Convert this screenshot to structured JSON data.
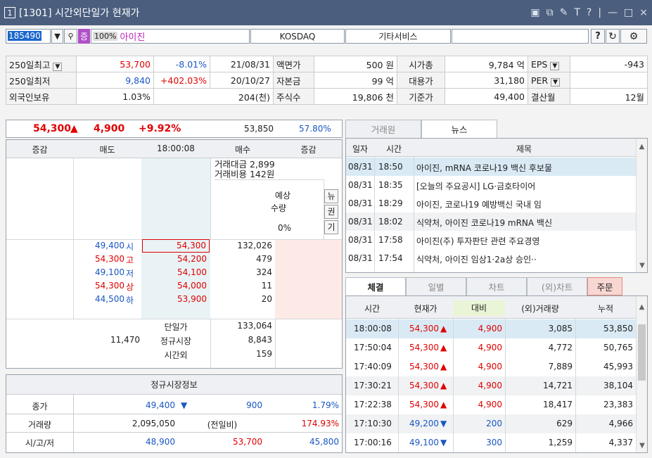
{
  "window": {
    "num": "1",
    "title": "[1301] 시간외단일가 현재가",
    "controls": [
      "▣",
      "⧉",
      "✎",
      "T",
      "?",
      "|",
      "—",
      "□",
      "×"
    ]
  },
  "toolbar": {
    "code": "185490",
    "badge": "증",
    "margin": "100%",
    "name": "아이진",
    "market": "KOSDAQ",
    "sector": "기타서비스",
    "help": "?",
    "refresh": "↻",
    "settings": "⚙"
  },
  "info": {
    "rows": [
      {
        "label": "250일최고",
        "value": "53,700",
        "change": "-8.01%",
        "date": "21/08/31",
        "k1": "액면가",
        "v1": "500 원",
        "k2": "시가총",
        "v2": "9,784 억",
        "k3": "EPS",
        "v3": "-943"
      },
      {
        "label": "250일최저",
        "value": "9,840",
        "change": "+402.03%",
        "date": "20/10/27",
        "k1": "자본금",
        "v1": "99 억",
        "k2": "대용가",
        "v2": "31,180",
        "k3": "PER",
        "v3": ""
      },
      {
        "label": "외국인보유",
        "value": "1.03%",
        "change": "",
        "date": "204(천)",
        "k1": "주식수",
        "v1": "19,806 천",
        "k2": "기준가",
        "v2": "49,400",
        "k3": "결산월",
        "v3": "12월"
      }
    ]
  },
  "quote": {
    "price": "54,300",
    "diff": "4,900",
    "rate": "+9.92%",
    "volume": "53,850",
    "ratio": "57.80%"
  },
  "orderbook": {
    "headers": [
      "증감",
      "매도",
      "18:00:08",
      "매수",
      "증감"
    ],
    "amount": "거래대금 2,899",
    "cost": "거래비용 142원",
    "expect_label1": "예상",
    "expect_label2": "수량",
    "expect_value": "0%",
    "side_btns": [
      "뉴",
      "권",
      "기"
    ],
    "rows": [
      {
        "ref": "49,400",
        "tag": "시",
        "price": "54,300",
        "buy": "132,026",
        "color": "blue"
      },
      {
        "ref": "54,300",
        "tag": "고",
        "price": "54,200",
        "buy": "479",
        "color": "red"
      },
      {
        "ref": "49,100",
        "tag": "저",
        "price": "54,100",
        "buy": "324",
        "color": "blue"
      },
      {
        "ref": "54,300",
        "tag": "상",
        "price": "54,000",
        "buy": "11",
        "color": "red"
      },
      {
        "ref": "44,500",
        "tag": "하",
        "price": "53,900",
        "buy": "20",
        "color": "blue"
      }
    ],
    "sum_left": "11,470",
    "sum_labels": [
      "단일가",
      "정규시장",
      "시간외"
    ],
    "sum_values": [
      "133,064",
      "8,843",
      "159"
    ]
  },
  "regular": {
    "title": "정규시장정보",
    "rows": [
      {
        "k": "종가",
        "a": "49,400",
        "mark": "▼",
        "b": "900",
        "c": "1.79%"
      },
      {
        "k": "거래량",
        "a": "2,095,050",
        "mark": "",
        "b": "(전일비)",
        "c": "174.93%"
      },
      {
        "k": "시/고/저",
        "a": "48,900",
        "mark": "",
        "b": "53,700",
        "c": "45,800"
      }
    ]
  },
  "news": {
    "tabs": [
      "거래원",
      "뉴스"
    ],
    "headers": [
      "일자",
      "시간",
      "제목"
    ],
    "rows": [
      {
        "d": "08/31",
        "t": "18:50",
        "s": "아이진, mRNA 코로나19 백신 후보물"
      },
      {
        "d": "08/31",
        "t": "18:35",
        "s": "[오늘의 주요공시] LG·금호타이어"
      },
      {
        "d": "08/31",
        "t": "18:29",
        "s": "아이진, 코로나19 예방백신 국내 임"
      },
      {
        "d": "08/31",
        "t": "18:02",
        "s": "식약처, 아이진 코로나19 mRNA 백신"
      },
      {
        "d": "08/31",
        "t": "17:58",
        "s": "아이진(주) 투자판단 관련 주요경영"
      },
      {
        "d": "08/31",
        "t": "17:54",
        "s": "식약처, 아이진 임상1·2a상 승인··"
      }
    ]
  },
  "trades": {
    "tabs": [
      "체결",
      "일별",
      "차트",
      "(외)차트",
      "주문"
    ],
    "headers": [
      "시간",
      "현재가",
      "대비",
      "(외)거래량",
      "누적"
    ],
    "rows": [
      {
        "t": "18:00:08",
        "p": "54,300",
        "up": true,
        "d": "4,900",
        "v": "3,085",
        "a": "53,850"
      },
      {
        "t": "17:50:04",
        "p": "54,300",
        "up": true,
        "d": "4,900",
        "v": "4,772",
        "a": "50,765"
      },
      {
        "t": "17:40:09",
        "p": "54,300",
        "up": true,
        "d": "4,900",
        "v": "7,889",
        "a": "45,993"
      },
      {
        "t": "17:30:21",
        "p": "54,300",
        "up": true,
        "d": "4,900",
        "v": "14,721",
        "a": "38,104"
      },
      {
        "t": "17:22:38",
        "p": "54,300",
        "up": true,
        "d": "4,900",
        "v": "18,417",
        "a": "23,383"
      },
      {
        "t": "17:10:30",
        "p": "49,200",
        "up": false,
        "d": "200",
        "v": "629",
        "a": "4,966"
      },
      {
        "t": "17:00:16",
        "p": "49,100",
        "up": false,
        "d": "300",
        "v": "1,259",
        "a": "4,337"
      }
    ]
  },
  "colors": {
    "up": "#e00000",
    "down": "#1a56c4",
    "title": "#4b5e7e"
  }
}
